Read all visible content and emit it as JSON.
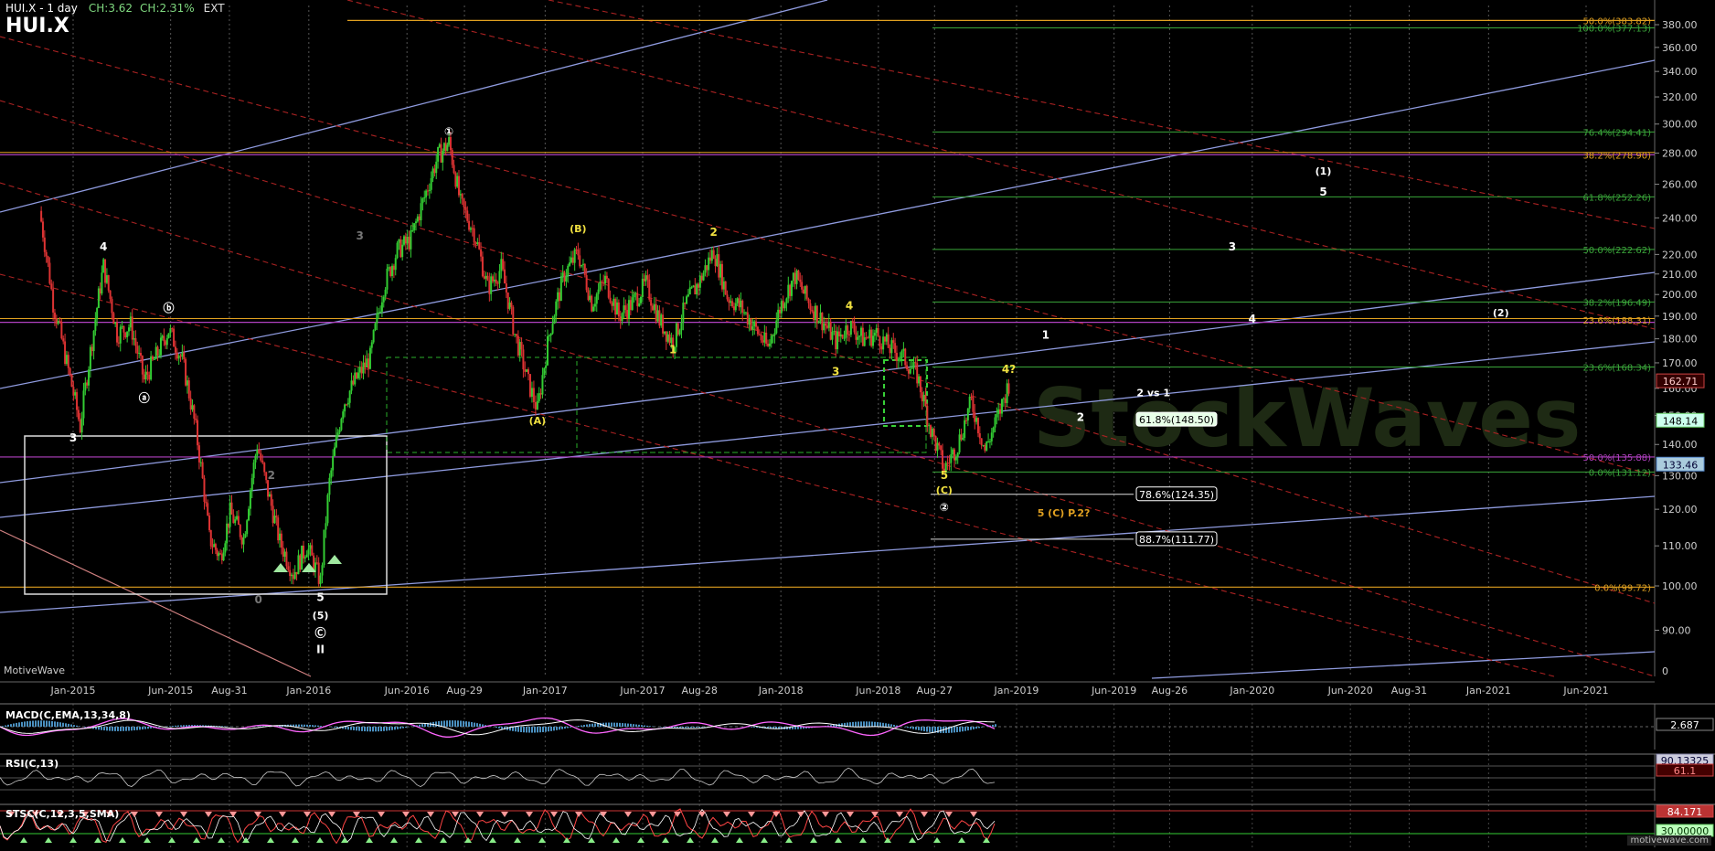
{
  "header": {
    "symbol_interval": "HUI.X - 1 day",
    "change_abs": "CH:3.62",
    "change_pct": "CH:2.31%",
    "session": "EXT",
    "big_symbol": "HUI.X"
  },
  "brand": "MotiveWave",
  "site": "motivewave.com",
  "colors": {
    "background": "#000000",
    "up_candle": "#33cc33",
    "down_candle": "#dd3333",
    "trend_blue": "#8f9bdf",
    "trend_red": "#aa2222",
    "fib_green": "#3aa63a",
    "fib_orange": "#e0a020",
    "fib_purple": "#b040c0",
    "wave_yellow": "#f0e040"
  },
  "chart_data": {
    "type": "candlestick",
    "x_ticks": [
      "Jan-2015",
      "Jun-2015",
      "Aug-31",
      "Jan-2016",
      "Jun-2016",
      "Aug-29",
      "Jan-2017",
      "Jun-2017",
      "Aug-28",
      "Jan-2018",
      "Jun-2018",
      "Aug-27",
      "Jan-2019",
      "Jun-2019",
      "Aug-26",
      "Jan-2020",
      "Jun-2020",
      "Aug-31",
      "Jan-2021",
      "Jun-2021"
    ],
    "y_ticks": [
      90,
      100,
      110,
      120,
      130,
      140,
      150,
      160,
      170,
      180,
      190,
      200,
      210,
      220,
      240,
      260,
      280,
      300,
      320,
      340,
      360,
      380
    ],
    "y_scale": "log",
    "ylim": [
      82,
      410
    ],
    "price_path": [
      [
        "2014-11-10",
        244
      ],
      [
        "2014-12-01",
        196
      ],
      [
        "2014-12-22",
        170
      ],
      [
        "2015-01-12",
        146
      ],
      [
        "2015-02-02",
        184
      ],
      [
        "2015-02-17",
        214
      ],
      [
        "2015-03-10",
        182
      ],
      [
        "2015-03-31",
        186
      ],
      [
        "2015-04-21",
        163
      ],
      [
        "2015-05-12",
        174
      ],
      [
        "2015-05-29",
        184
      ],
      [
        "2015-06-19",
        171
      ],
      [
        "2015-07-10",
        145
      ],
      [
        "2015-07-31",
        112
      ],
      [
        "2015-08-17",
        107
      ],
      [
        "2015-09-01",
        119
      ],
      [
        "2015-09-22",
        112
      ],
      [
        "2015-10-13",
        140
      ],
      [
        "2015-10-27",
        127
      ],
      [
        "2015-11-17",
        111
      ],
      [
        "2015-12-08",
        103
      ],
      [
        "2015-12-29",
        110
      ],
      [
        "2016-01-19",
        101
      ],
      [
        "2016-02-02",
        128
      ],
      [
        "2016-02-23",
        154
      ],
      [
        "2016-03-15",
        164
      ],
      [
        "2016-04-05",
        172
      ],
      [
        "2016-04-26",
        204
      ],
      [
        "2016-05-17",
        222
      ],
      [
        "2016-06-07",
        228
      ],
      [
        "2016-06-28",
        252
      ],
      [
        "2016-07-19",
        278
      ],
      [
        "2016-08-05",
        287
      ],
      [
        "2016-08-23",
        248
      ],
      [
        "2016-09-13",
        232
      ],
      [
        "2016-10-04",
        203
      ],
      [
        "2016-10-25",
        213
      ],
      [
        "2016-11-15",
        182
      ],
      [
        "2016-12-06",
        162
      ],
      [
        "2016-12-20",
        152
      ],
      [
        "2017-01-10",
        186
      ],
      [
        "2017-01-31",
        210
      ],
      [
        "2017-02-21",
        221
      ],
      [
        "2017-03-14",
        196
      ],
      [
        "2017-04-04",
        207
      ],
      [
        "2017-04-25",
        190
      ],
      [
        "2017-05-16",
        196
      ],
      [
        "2017-06-06",
        205
      ],
      [
        "2017-06-27",
        188
      ],
      [
        "2017-07-18",
        178
      ],
      [
        "2017-08-08",
        196
      ],
      [
        "2017-08-29",
        207
      ],
      [
        "2017-09-19",
        222
      ],
      [
        "2017-10-10",
        199
      ],
      [
        "2017-10-31",
        194
      ],
      [
        "2017-11-21",
        185
      ],
      [
        "2017-12-12",
        176
      ],
      [
        "2018-01-02",
        196
      ],
      [
        "2018-01-23",
        209
      ],
      [
        "2018-02-13",
        196
      ],
      [
        "2018-03-06",
        188
      ],
      [
        "2018-03-27",
        179
      ],
      [
        "2018-04-17",
        186
      ],
      [
        "2018-05-08",
        180
      ],
      [
        "2018-05-29",
        182
      ],
      [
        "2018-06-19",
        176
      ],
      [
        "2018-07-10",
        172
      ],
      [
        "2018-07-31",
        165
      ],
      [
        "2018-08-21",
        145
      ],
      [
        "2018-09-11",
        132
      ],
      [
        "2018-10-02",
        140
      ],
      [
        "2018-10-23",
        155
      ],
      [
        "2018-11-13",
        138
      ],
      [
        "2018-12-04",
        150
      ],
      [
        "2018-12-20",
        162
      ]
    ],
    "last_prices": {
      "close": "148.14",
      "high": "162.71",
      "low": "133.46"
    },
    "fib_labels": [
      {
        "text": "50.0%(383.82)",
        "price": 383.82,
        "color": "orange"
      },
      {
        "text": "100.0%(377.13)",
        "price": 377.13,
        "color": "green"
      },
      {
        "text": "76.4%(294.41)",
        "price": 294.41,
        "color": "green"
      },
      {
        "text": "38.2%(278.90)",
        "price": 278.9,
        "color": "orange"
      },
      {
        "text": "61.8%(252.26)",
        "price": 252.26,
        "color": "green"
      },
      {
        "text": "50.0%(222.62)",
        "price": 222.62,
        "color": "green"
      },
      {
        "text": "38.2%(196.49)",
        "price": 196.49,
        "color": "green"
      },
      {
        "text": "23.6%(188.31)",
        "price": 188.31,
        "color": "orange"
      },
      {
        "text": "23.6%(168.34)",
        "price": 168.34,
        "color": "green"
      },
      {
        "text": "50.0%(135.88)",
        "price": 135.88,
        "color": "purple"
      },
      {
        "text": "0.0%(131.12)",
        "price": 131.12,
        "color": "green"
      },
      {
        "text": "0.0%(99.72)",
        "price": 99.72,
        "color": "orange"
      }
    ],
    "boxed_labels": [
      {
        "text": "61.8%(148.50)",
        "price": 148.5,
        "filled": true
      },
      {
        "text": "78.6%(124.35)",
        "price": 124.35,
        "filled": false
      },
      {
        "text": "88.7%(111.77)",
        "price": 111.77,
        "filled": false
      }
    ],
    "wave_labels": [
      {
        "text": "3",
        "date": "2015-01-01",
        "price": 141,
        "color": "white"
      },
      {
        "text": "4",
        "date": "2015-02-17",
        "price": 222,
        "color": "white"
      },
      {
        "text": "ⓐ",
        "date": "2015-04-21",
        "price": 155,
        "color": "white"
      },
      {
        "text": "ⓑ",
        "date": "2015-05-29",
        "price": 192,
        "color": "white"
      },
      {
        "text": "2",
        "date": "2015-11-04",
        "price": 129,
        "color": "grey"
      },
      {
        "text": "0",
        "date": "2015-10-15",
        "price": 96,
        "color": "grey"
      },
      {
        "text": "5",
        "date": "2016-01-19",
        "price": 96.5,
        "color": "white"
      },
      {
        "text": "(5)",
        "date": "2016-01-19",
        "price": 92.5,
        "color": "white"
      },
      {
        "text": "Ⓒ",
        "date": "2016-01-19",
        "price": 88.6,
        "color": "white"
      },
      {
        "text": "II",
        "date": "2016-01-19",
        "price": 85.2,
        "color": "white"
      },
      {
        "text": "3",
        "date": "2016-03-20",
        "price": 228,
        "color": "grey"
      },
      {
        "text": "①",
        "date": "2016-08-05",
        "price": 292,
        "color": "white"
      },
      {
        "text": "(A)",
        "date": "2016-12-20",
        "price": 147,
        "color": "yellow"
      },
      {
        "text": "(B)",
        "date": "2017-02-21",
        "price": 232,
        "color": "yellow"
      },
      {
        "text": "1",
        "date": "2017-07-18",
        "price": 174,
        "color": "yellow"
      },
      {
        "text": "2",
        "date": "2017-09-19",
        "price": 230,
        "color": "yellow"
      },
      {
        "text": "3",
        "date": "2018-03-27",
        "price": 165,
        "color": "yellow"
      },
      {
        "text": "4",
        "date": "2018-04-17",
        "price": 193,
        "color": "yellow"
      },
      {
        "text": "4?",
        "date": "2018-12-20",
        "price": 166,
        "color": "yellow"
      },
      {
        "text": "5",
        "date": "2018-09-11",
        "price": 129,
        "color": "yellow"
      },
      {
        "text": "(C)",
        "date": "2018-09-11",
        "price": 124.5,
        "color": "yellow"
      },
      {
        "text": "②",
        "date": "2018-09-11",
        "price": 119.5,
        "color": "white"
      },
      {
        "text": "1",
        "date": "2019-02-15",
        "price": 180,
        "color": "white"
      },
      {
        "text": "2",
        "date": "2019-04-10",
        "price": 148,
        "color": "white"
      },
      {
        "text": "2 vs 1",
        "date": "2019-08-01",
        "price": 157,
        "color": "white"
      },
      {
        "text": "5 (C) P.2?",
        "date": "2019-03-15",
        "price": 118,
        "color": "orange"
      },
      {
        "text": "3",
        "date": "2019-12-01",
        "price": 222,
        "color": "white"
      },
      {
        "text": "4",
        "date": "2020-01-01",
        "price": 187,
        "color": "white"
      },
      {
        "text": "(1)",
        "date": "2020-04-20",
        "price": 266,
        "color": "white"
      },
      {
        "text": "5",
        "date": "2020-04-20",
        "price": 253,
        "color": "white"
      },
      {
        "text": "(2)",
        "date": "2021-01-20",
        "price": 190,
        "color": "white"
      }
    ],
    "indicators": [
      {
        "name": "MACD(C,EMA,13,34,8)",
        "value": "2.687"
      },
      {
        "name": "RSI(C,13)",
        "value": "90.13325",
        "value2": "61.1"
      },
      {
        "name": "STSC(C,12,3,5,SMA)",
        "value": "84.171",
        "value2": "30.00000"
      }
    ],
    "axis_extra": "0",
    "watermark": "StockWaves"
  }
}
